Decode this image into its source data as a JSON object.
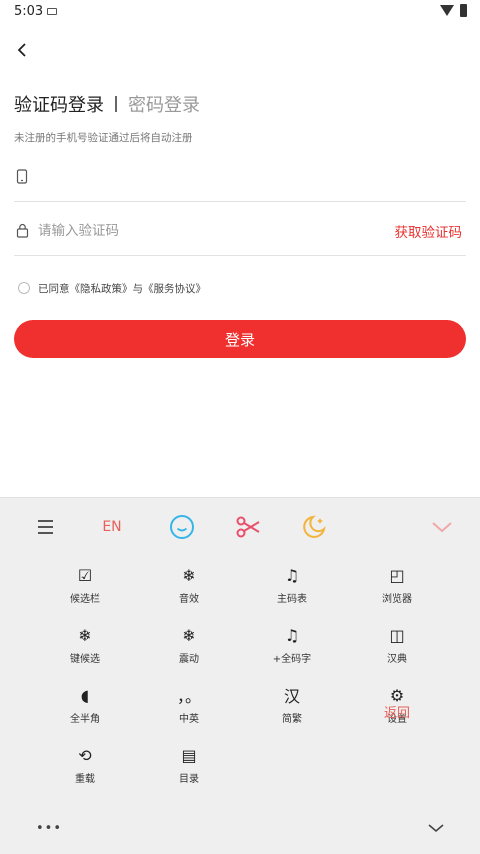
{
  "status": {
    "time": "5:03"
  },
  "tabs": {
    "active": "验证码登录",
    "inactive": "密码登录"
  },
  "hint": "未注册的手机号验证通过后将自动注册",
  "phone_field": {
    "value": "",
    "placeholder": ""
  },
  "code_field": {
    "value": "",
    "placeholder": "请输入验证码",
    "get_code_label": "获取验证码"
  },
  "agreement": {
    "text": "已同意《隐私政策》与《服务协议》"
  },
  "login_button": "登录",
  "colors": {
    "accent": "#f0302f",
    "keyboard_bg": "#efefef",
    "kb_accent": "#e8605a"
  },
  "keyboard": {
    "toolbar": {
      "menu_icon": "menu-icon",
      "en_label": "EN",
      "emoji_icon": "emoji-icon",
      "clip_icon": "scissors-icon",
      "theme_icon": "moon-icon",
      "collapse_icon": "chevron-down-icon"
    },
    "keys": [
      {
        "symbol": "☑",
        "label": "候选栏"
      },
      {
        "symbol": "❄",
        "label": "音效"
      },
      {
        "symbol": "♫",
        "label": "主码表"
      },
      {
        "symbol": "◰",
        "label": "浏览器"
      },
      {
        "symbol": "❄",
        "label": "键候选"
      },
      {
        "symbol": "❄",
        "label": "震动"
      },
      {
        "symbol": "♫",
        "label": "+全码字"
      },
      {
        "symbol": "◫",
        "label": "汉典"
      },
      {
        "symbol": "◖",
        "label": "全半角"
      },
      {
        "symbol": "，。",
        "label": "中英"
      },
      {
        "symbol": "汉",
        "label": "简繁"
      },
      {
        "symbol": "⚙",
        "label": "设置"
      },
      {
        "symbol": "⟲",
        "label": "重载"
      },
      {
        "symbol": "▤",
        "label": "目录"
      }
    ],
    "return_label": "返回",
    "more_label": "•••"
  }
}
